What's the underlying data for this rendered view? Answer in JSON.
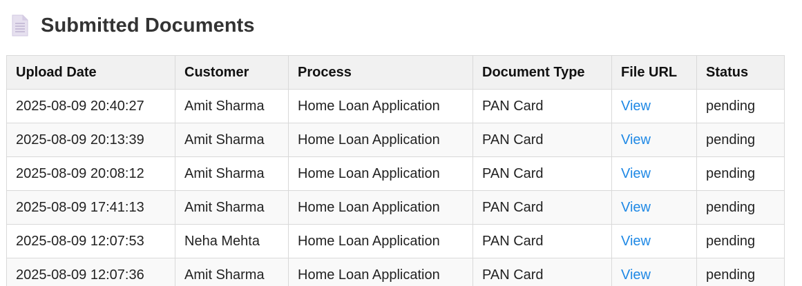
{
  "page": {
    "title": "Submitted Documents",
    "icon": "document-icon"
  },
  "table": {
    "headers": {
      "upload_date": "Upload Date",
      "customer": "Customer",
      "process": "Process",
      "document_type": "Document Type",
      "file_url": "File URL",
      "status": "Status"
    },
    "rows": [
      {
        "upload_date": "2025-08-09 20:40:27",
        "customer": "Amit Sharma",
        "process": "Home Loan Application",
        "document_type": "PAN Card",
        "file_url": "View",
        "status": "pending"
      },
      {
        "upload_date": "2025-08-09 20:13:39",
        "customer": "Amit Sharma",
        "process": "Home Loan Application",
        "document_type": "PAN Card",
        "file_url": "View",
        "status": "pending"
      },
      {
        "upload_date": "2025-08-09 20:08:12",
        "customer": "Amit Sharma",
        "process": "Home Loan Application",
        "document_type": "PAN Card",
        "file_url": "View",
        "status": "pending"
      },
      {
        "upload_date": "2025-08-09 17:41:13",
        "customer": "Amit Sharma",
        "process": "Home Loan Application",
        "document_type": "PAN Card",
        "file_url": "View",
        "status": "pending"
      },
      {
        "upload_date": "2025-08-09 12:07:53",
        "customer": "Neha Mehta",
        "process": "Home Loan Application",
        "document_type": "PAN Card",
        "file_url": "View",
        "status": "pending"
      },
      {
        "upload_date": "2025-08-09 12:07:36",
        "customer": "Amit Sharma",
        "process": "Home Loan Application",
        "document_type": "PAN Card",
        "file_url": "View",
        "status": "pending"
      }
    ]
  },
  "colors": {
    "link": "#1e88e5",
    "header_bg": "#f1f1f1",
    "border": "#d9d9d9"
  }
}
